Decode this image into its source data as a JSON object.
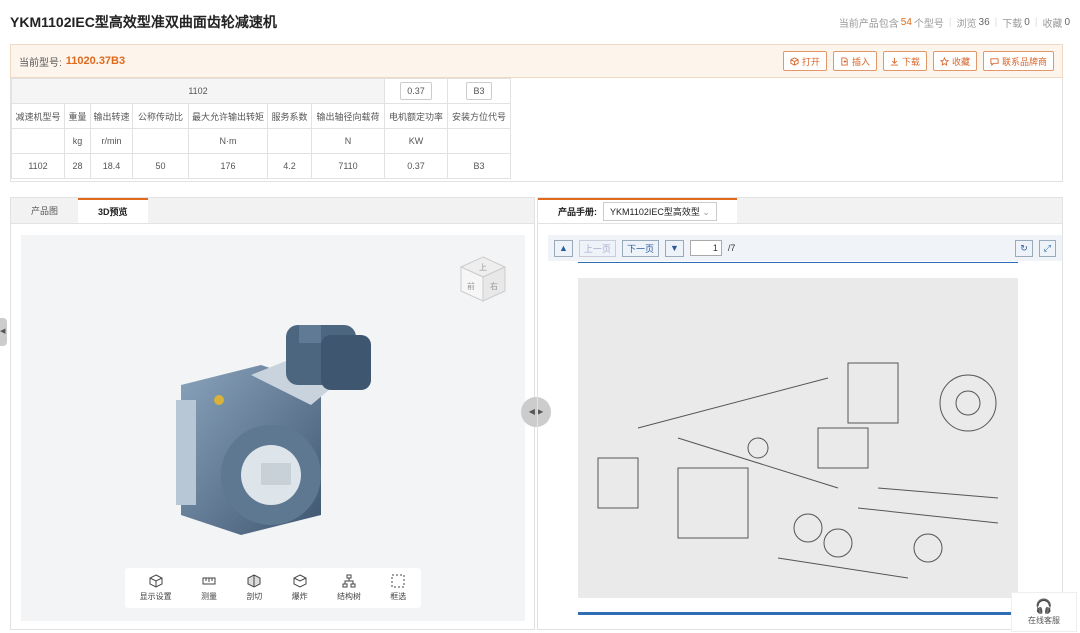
{
  "header": {
    "title": "YKM1102IEC型高效型准双曲面齿轮减速机",
    "stat_prefix": "当前产品包含",
    "stat_count": "54",
    "stat_suffix": "个型号",
    "views_label": "浏览",
    "views": "36",
    "downloads_label": "下载",
    "downloads": "0",
    "favorites_label": "收藏",
    "favorites": "0"
  },
  "model": {
    "label": "当前型号:",
    "value": "11020.37B3"
  },
  "actions": [
    {
      "label": "打开",
      "icon": "cube-icon"
    },
    {
      "label": "插入",
      "icon": "insert-icon"
    },
    {
      "label": "下载",
      "icon": "download-icon"
    },
    {
      "label": "收藏",
      "icon": "star-icon"
    },
    {
      "label": "联系品牌商",
      "icon": "message-icon"
    }
  ],
  "params": {
    "group_value": "1102",
    "power_option": "0.37",
    "mount_option": "B3",
    "headers": [
      "减速机型号",
      "重量",
      "输出转速",
      "公称传动比",
      "最大允许输出转矩",
      "服务系数",
      "输出轴径向载荷",
      "电机额定功率",
      "安装方位代号"
    ],
    "units": [
      "",
      "kg",
      "r/min",
      "",
      "N·m",
      "",
      "N",
      "KW",
      ""
    ],
    "row": [
      "1102",
      "28",
      "18.4",
      "50",
      "176",
      "4.2",
      "7110",
      "0.37",
      "B3"
    ]
  },
  "left_tabs": {
    "tab1": "产品图",
    "tab2": "3D预览"
  },
  "tools": [
    "显示设置",
    "测量",
    "剖切",
    "爆炸",
    "结构树",
    "框选"
  ],
  "viewcube": {
    "top": "上",
    "front": "前",
    "right": "右"
  },
  "manual": {
    "label": "产品手册:",
    "select": "YKM1102IEC型高效型",
    "prev": "上一页",
    "next": "下一页",
    "page": "1",
    "total": "/7"
  },
  "service": {
    "label": "在线客服"
  }
}
